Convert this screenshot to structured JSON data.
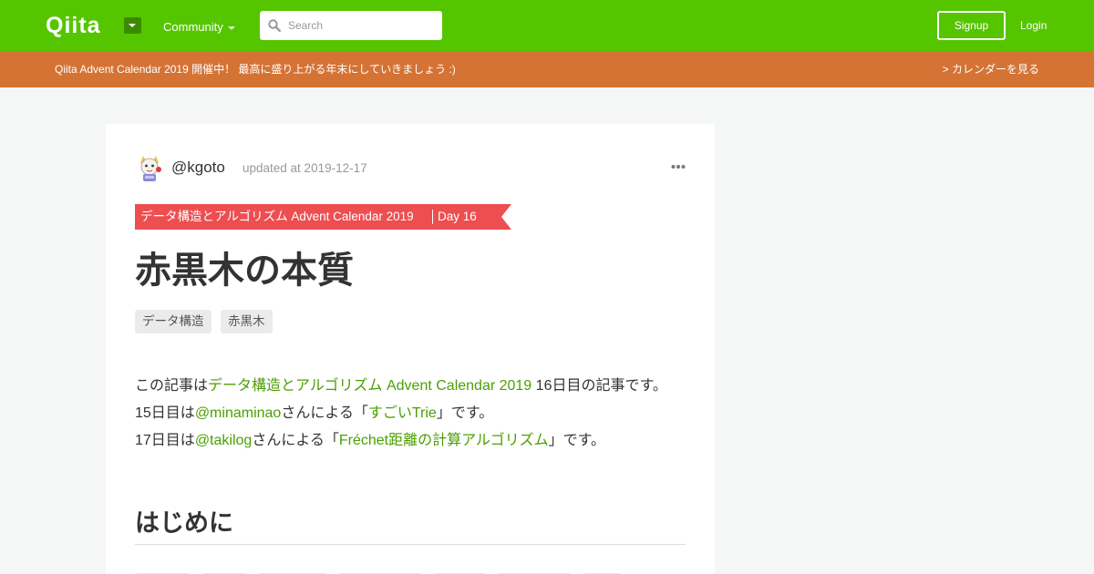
{
  "header": {
    "logo": "Qiita",
    "community_label": "Community",
    "search_placeholder": "Search",
    "signup_label": "Signup",
    "login_label": "Login",
    "brand_color": "#55c500"
  },
  "banner": {
    "text": "Qiita Advent Calendar 2019 開催中！ 最高に盛り上がる年末にしていきましょう :)",
    "link": "> カレンダーを見る",
    "color": "#d57335"
  },
  "article": {
    "author": "@kgoto",
    "updated": "updated at 2019-12-17",
    "calendar_ribbon": {
      "calendar": "データ構造とアルゴリズム Advent Calendar 2019",
      "day": "Day 16",
      "color": "#ed4e50"
    },
    "title": "赤黒木の本質",
    "tags": [
      "データ構造",
      "赤黒木"
    ],
    "intro": {
      "line1": {
        "prefix": "この記事は",
        "link": "データ構造とアルゴリズム Advent Calendar 2019",
        "suffix": " 16日目の記事です。"
      },
      "line2": {
        "prefix": "15日目は",
        "user": "@minaminao",
        "middle": "さんによる「",
        "link": "すごいTrie",
        "suffix": "」です。"
      },
      "line3": {
        "prefix": "17日目は",
        "user": "@takilog",
        "middle": "さんによる「",
        "link": "Fréchet距離の計算アルゴリズム",
        "suffix": "」です。"
      }
    },
    "section_heading": "はじめに"
  }
}
